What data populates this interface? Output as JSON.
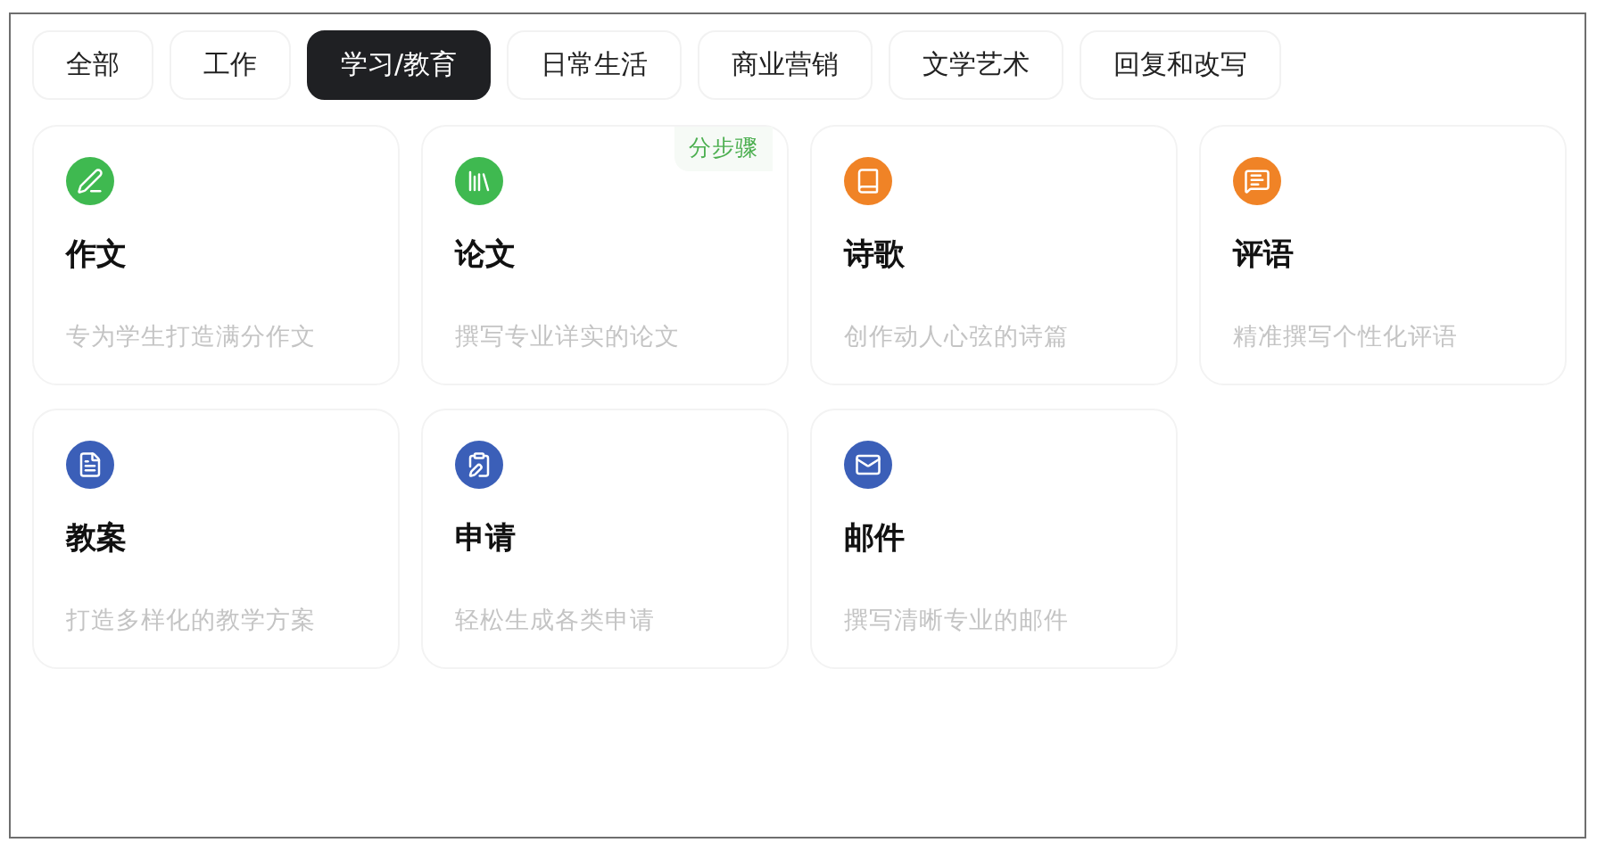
{
  "tabs": [
    {
      "label": "全部",
      "selected": false
    },
    {
      "label": "工作",
      "selected": false
    },
    {
      "label": "学习/教育",
      "selected": true
    },
    {
      "label": "日常生活",
      "selected": false
    },
    {
      "label": "商业营销",
      "selected": false
    },
    {
      "label": "文学艺术",
      "selected": false
    },
    {
      "label": "回复和改写",
      "selected": false
    }
  ],
  "cards": [
    {
      "title": "作文",
      "description": "专为学生打造满分作文",
      "color": "#3fb950"
    },
    {
      "title": "论文",
      "description": "撰写专业详实的论文",
      "color": "#3fb950",
      "badge": "分步骤"
    },
    {
      "title": "诗歌",
      "description": "创作动人心弦的诗篇",
      "color": "#f08326"
    },
    {
      "title": "评语",
      "description": "精准撰写个性化评语",
      "color": "#f08326"
    },
    {
      "title": "教案",
      "description": "打造多样化的教学方案",
      "color": "#3b5fb8"
    },
    {
      "title": "申请",
      "description": "轻松生成各类申请",
      "color": "#3b5fb8"
    },
    {
      "title": "邮件",
      "description": "撰写清晰专业的邮件",
      "color": "#3b5fb8"
    }
  ]
}
